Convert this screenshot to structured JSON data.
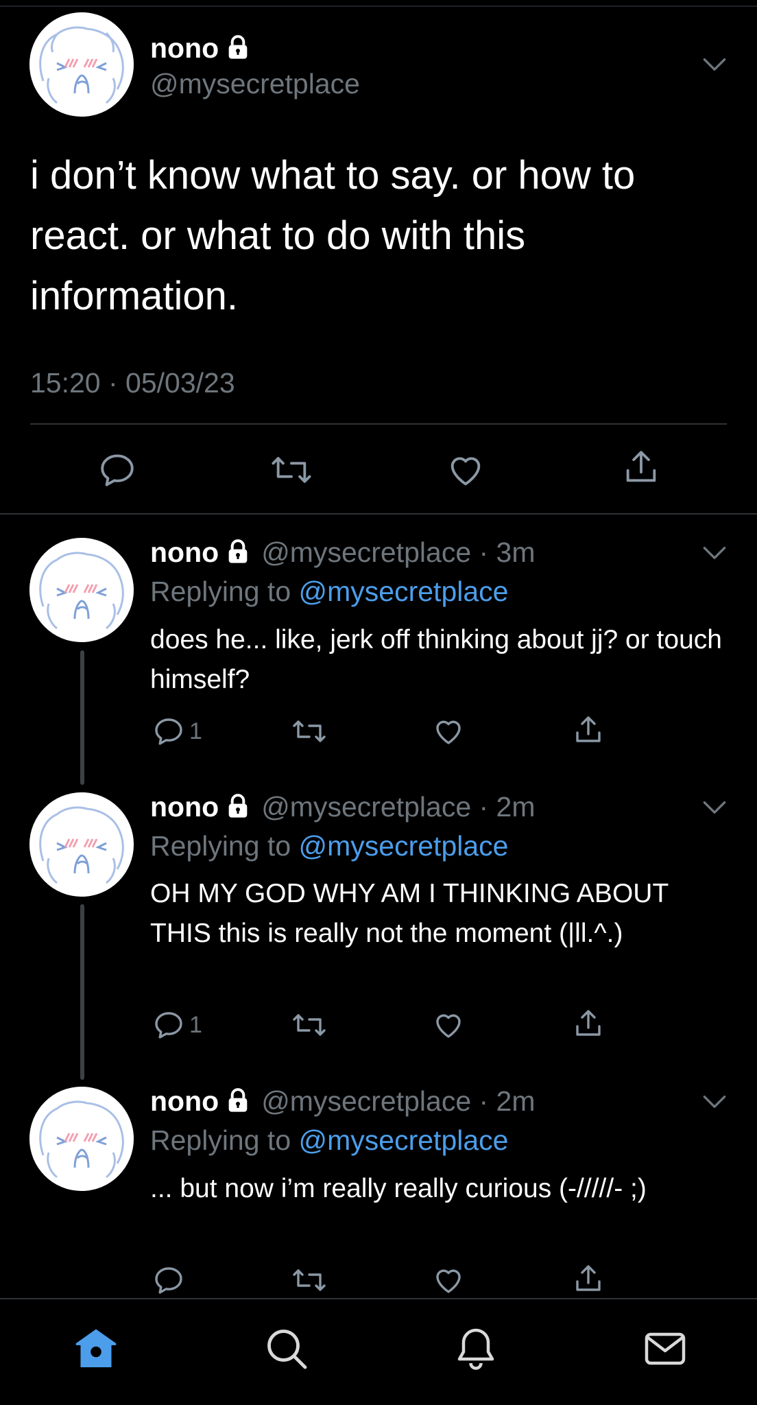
{
  "colors": {
    "background": "#000000",
    "text": "#ffffff",
    "muted": "#6e767d",
    "accent": "#4c9eeb",
    "divider": "#2f3336"
  },
  "main_tweet": {
    "name": "nono",
    "handle": "@mysecretplace",
    "text": "i don’t know what to say. or how to react. or what to do with this information.",
    "timestamp": "15:20 · 05/03/23",
    "icons": [
      "reply-icon",
      "retweet-icon",
      "like-icon",
      "share-icon"
    ]
  },
  "replies": [
    {
      "name": "nono",
      "handle_time": "@mysecretplace · 3m",
      "replying_prefix": "Replying to ",
      "replying_to": "@mysecretplace",
      "text": "does he... like, jerk off thinking about jj? or touch himself?",
      "reply_count": "1"
    },
    {
      "name": "nono",
      "handle_time": "@mysecretplace · 2m",
      "replying_prefix": "Replying to ",
      "replying_to": "@mysecretplace",
      "text": "OH MY GOD WHY AM I THINKING ABOUT THIS this is really not the moment (|ll.^.)",
      "reply_count": "1"
    },
    {
      "name": "nono",
      "handle_time": "@mysecretplace · 2m",
      "replying_prefix": "Replying to ",
      "replying_to": "@mysecretplace",
      "text": "... but now i’m really really curious (-/////- ;)",
      "reply_count": ""
    }
  ],
  "tabbar": {
    "items": [
      "home-icon",
      "search-icon",
      "notifications-icon",
      "messages-icon"
    ],
    "active": "home-icon"
  }
}
